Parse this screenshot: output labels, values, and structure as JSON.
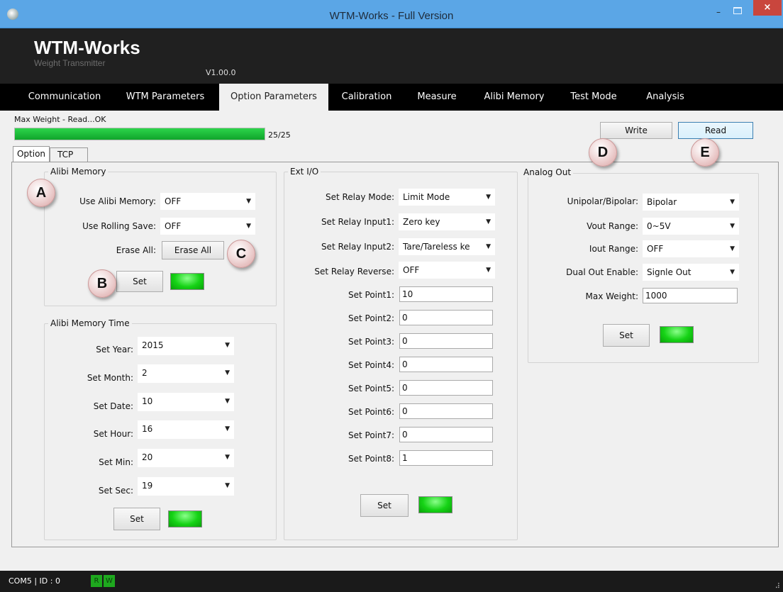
{
  "window": {
    "title": "WTM-Works - Full Version",
    "minimize_glyph": "–",
    "maximize_glyph": "□",
    "close_glyph": "×"
  },
  "header": {
    "brand": "WTM-Works",
    "subtitle": "Weight Transmitter",
    "version": "V1.00.0"
  },
  "nav": {
    "tabs": [
      "Communication",
      "WTM Parameters",
      "Option Parameters",
      "Calibration",
      "Measure",
      "Alibi Memory",
      "Test Mode",
      "Analysis"
    ],
    "active_index": 2
  },
  "status": {
    "message": "Max Weight - Read...OK",
    "progress_label": "25/25",
    "progress_fraction": 1.0
  },
  "actions": {
    "write": "Write",
    "read": "Read"
  },
  "subtabs": {
    "option": "Option",
    "tcp": "TCP"
  },
  "alibi_memory": {
    "title": "Alibi Memory",
    "use_alibi_label": "Use Alibi Memory:",
    "use_alibi_value": "OFF",
    "rolling_save_label": "Use Rolling Save:",
    "rolling_save_value": "OFF",
    "erase_label": "Erase All:",
    "erase_button": "Erase All",
    "set_button": "Set"
  },
  "alibi_time": {
    "title": "Alibi Memory Time",
    "rows": [
      {
        "label": "Set Year:",
        "value": "2015"
      },
      {
        "label": "Set Month:",
        "value": "2"
      },
      {
        "label": "Set Date:",
        "value": "10"
      },
      {
        "label": "Set Hour:",
        "value": "16"
      },
      {
        "label": "Set Min:",
        "value": "20"
      },
      {
        "label": "Set Sec:",
        "value": "19"
      }
    ],
    "set_button": "Set"
  },
  "ext_io": {
    "title": "Ext I/O",
    "selects": [
      {
        "label": "Set Relay Mode:",
        "value": "Limit Mode"
      },
      {
        "label": "Set Relay Input1:",
        "value": "Zero key"
      },
      {
        "label": "Set Relay Input2:",
        "value": "Tare/Tareless ke"
      },
      {
        "label": "Set Relay Reverse:",
        "value": "OFF"
      }
    ],
    "points": [
      {
        "label": "Set Point1:",
        "value": "10"
      },
      {
        "label": "Set Point2:",
        "value": "0"
      },
      {
        "label": "Set Point3:",
        "value": "0"
      },
      {
        "label": "Set Point4:",
        "value": "0"
      },
      {
        "label": "Set Point5:",
        "value": "0"
      },
      {
        "label": "Set Point6:",
        "value": "0"
      },
      {
        "label": "Set Point7:",
        "value": "0"
      },
      {
        "label": "Set Point8:",
        "value": "1"
      }
    ],
    "set_button": "Set"
  },
  "analog_out": {
    "title": "Analog Out",
    "rows": [
      {
        "label": "Unipolar/Bipolar:",
        "value": "Bipolar"
      },
      {
        "label": "Vout Range:",
        "value": "0~5V"
      },
      {
        "label": "Iout Range:",
        "value": "OFF"
      },
      {
        "label": "Dual Out Enable:",
        "value": "Signle Out"
      }
    ],
    "max_weight_label": "Max Weight:",
    "max_weight_value": "1000",
    "set_button": "Set"
  },
  "callouts": {
    "a": "A",
    "b": "B",
    "c": "C",
    "d": "D",
    "e": "E"
  },
  "footer": {
    "connection": "COM5 | ID : 0",
    "rx": "R",
    "tx": "W",
    "grip": "⠼"
  },
  "colors": {
    "titlebar": "#5ba6e6",
    "header": "#202020",
    "nav": "#000000",
    "led_green": "#16d316",
    "close_red": "#c9463d"
  }
}
